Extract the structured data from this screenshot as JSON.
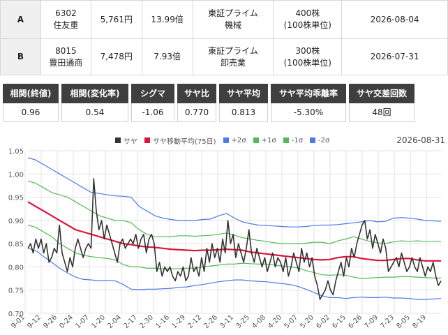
{
  "pairs": [
    {
      "label": "A",
      "code": "6302",
      "name": "住友重",
      "price": "5,761円",
      "per": "13.99倍",
      "market": "東証プライム",
      "sector": "機械",
      "shares": "400株",
      "unit": "(100株単位)",
      "date": "2026-08-04"
    },
    {
      "label": "B",
      "code": "8015",
      "name": "豊田通商",
      "price": "7,478円",
      "per": "7.93倍",
      "market": "東証プライム",
      "sector": "卸売業",
      "shares": "300株",
      "unit": "(100株単位)",
      "date": "2026-07-31"
    }
  ],
  "stats": [
    {
      "label": "相関(終値)",
      "value": "0.96"
    },
    {
      "label": "相関(変化率)",
      "value": "0.54"
    },
    {
      "label": "シグマ",
      "value": "-1.06"
    },
    {
      "label": "サヤ比",
      "value": "0.770"
    },
    {
      "label": "サヤ平均",
      "value": "0.813"
    },
    {
      "label": "サヤ平均乖離率",
      "value": "-5.30%"
    },
    {
      "label": "サヤ交差回数",
      "value": "48回"
    }
  ],
  "chart_data": {
    "type": "line",
    "date_label": "2026-08-31",
    "legend": [
      {
        "name": "サヤ",
        "color": "#333333"
      },
      {
        "name": "サヤ移動平均(75日)",
        "color": "#dc143c"
      },
      {
        "name": "+2σ",
        "color": "#4b7be5"
      },
      {
        "name": "+1σ",
        "color": "#55b855"
      },
      {
        "name": "-1σ",
        "color": "#55b855"
      },
      {
        "name": "-2σ",
        "color": "#4b7be5"
      }
    ],
    "colors": {
      "saya": "#333333",
      "ma": "#dc143c",
      "sigma2": "#4b7be5",
      "sigma1": "#55b855"
    },
    "ylim": [
      0.7,
      1.05
    ],
    "yticks": [
      "1.05",
      "1.00",
      "0.95",
      "0.90",
      "0.85",
      "0.80",
      "0.75",
      "0.70"
    ],
    "xticks": [
      "9-01",
      "9-12",
      "9-26",
      "0-24",
      "1-07",
      "1-20",
      "2-04",
      "2-17",
      "2-30",
      "1-16",
      "1-29",
      "2-12",
      "2-26",
      "3-11",
      "3-25",
      "4-08",
      "4-20",
      "5-07",
      "5-20",
      "6-02",
      "6-15",
      "6-26",
      "7-09",
      "7-23",
      "8-05",
      "8-19"
    ],
    "saya": [
      0.84,
      0.85,
      0.83,
      0.86,
      0.84,
      0.86,
      0.83,
      0.85,
      0.81,
      0.82,
      0.84,
      0.83,
      0.89,
      0.83,
      0.81,
      0.79,
      0.82,
      0.8,
      0.84,
      0.86,
      0.84,
      0.82,
      0.84,
      0.85,
      0.84,
      0.99,
      0.92,
      0.88,
      0.9,
      0.86,
      0.89,
      0.87,
      0.85,
      0.83,
      0.81,
      0.85,
      0.86,
      0.84,
      0.85,
      0.86,
      0.85,
      0.87,
      0.84,
      0.86,
      0.87,
      0.83,
      0.86,
      0.87,
      0.85,
      0.79,
      0.81,
      0.78,
      0.8,
      0.79,
      0.8,
      0.78,
      0.77,
      0.79,
      0.78,
      0.8,
      0.77,
      0.78,
      0.82,
      0.79,
      0.8,
      0.78,
      0.82,
      0.79,
      0.84,
      0.81,
      0.85,
      0.82,
      0.84,
      0.81,
      0.86,
      0.83,
      0.9,
      0.85,
      0.87,
      0.82,
      0.85,
      0.83,
      0.81,
      0.84,
      0.88,
      0.83,
      0.81,
      0.84,
      0.82,
      0.8,
      0.82,
      0.79,
      0.81,
      0.83,
      0.8,
      0.82,
      0.81,
      0.79,
      0.82,
      0.78,
      0.8,
      0.83,
      0.81,
      0.79,
      0.84,
      0.81,
      0.83,
      0.8,
      0.82,
      0.78,
      0.76,
      0.73,
      0.74,
      0.75,
      0.77,
      0.75,
      0.74,
      0.77,
      0.79,
      0.81,
      0.78,
      0.82,
      0.8,
      0.84,
      0.82,
      0.85,
      0.87,
      0.89,
      0.9,
      0.86,
      0.88,
      0.84,
      0.87,
      0.85,
      0.83,
      0.86,
      0.84,
      0.79,
      0.8,
      0.81,
      0.82,
      0.8,
      0.83,
      0.81,
      0.79,
      0.8,
      0.82,
      0.8,
      0.79,
      0.82,
      0.8,
      0.78,
      0.8,
      0.79,
      0.81,
      0.78,
      0.76,
      0.77
    ],
    "ma": [
      0.94,
      0.93,
      0.92,
      0.91,
      0.9,
      0.89,
      0.88,
      0.875,
      0.87,
      0.865,
      0.86,
      0.855,
      0.85,
      0.848,
      0.845,
      0.843,
      0.842,
      0.84,
      0.838,
      0.837,
      0.836,
      0.835,
      0.836,
      0.836,
      0.837,
      0.838,
      0.837,
      0.836,
      0.832,
      0.83,
      0.828,
      0.826,
      0.824,
      0.822,
      0.82,
      0.818,
      0.816,
      0.815,
      0.816,
      0.82,
      0.822,
      0.822,
      0.818,
      0.816,
      0.814,
      0.814,
      0.816,
      0.818,
      0.818,
      0.815,
      0.813,
      0.813,
      0.813
    ],
    "p2": [
      1.035,
      1.03,
      1.02,
      1.01,
      1.0,
      0.99,
      0.98,
      0.97,
      0.96,
      0.958,
      0.955,
      0.953,
      0.952,
      0.95,
      0.93,
      0.92,
      0.91,
      0.905,
      0.902,
      0.9,
      0.9,
      0.9,
      0.902,
      0.903,
      0.91,
      0.915,
      0.905,
      0.897,
      0.893,
      0.89,
      0.889,
      0.888,
      0.887,
      0.886,
      0.886,
      0.887,
      0.889,
      0.89,
      0.89,
      0.891,
      0.893,
      0.895,
      0.897,
      0.9,
      0.897,
      0.898,
      0.905,
      0.906,
      0.905,
      0.903,
      0.9,
      0.899,
      0.898
    ],
    "p1": [
      0.985,
      0.98,
      0.97,
      0.96,
      0.955,
      0.95,
      0.94,
      0.93,
      0.92,
      0.91,
      0.905,
      0.9,
      0.9,
      0.895,
      0.88,
      0.87,
      0.865,
      0.865,
      0.865,
      0.867,
      0.867,
      0.866,
      0.867,
      0.868,
      0.87,
      0.873,
      0.868,
      0.863,
      0.86,
      0.857,
      0.855,
      0.852,
      0.85,
      0.85,
      0.85,
      0.851,
      0.853,
      0.853,
      0.85,
      0.856,
      0.86,
      0.865,
      0.86,
      0.855,
      0.852,
      0.85,
      0.854,
      0.856,
      0.855,
      0.856,
      0.855,
      0.855,
      0.855
    ],
    "m1": [
      0.89,
      0.885,
      0.875,
      0.865,
      0.85,
      0.84,
      0.83,
      0.825,
      0.822,
      0.82,
      0.818,
      0.815,
      0.805,
      0.8,
      0.8,
      0.797,
      0.797,
      0.796,
      0.796,
      0.796,
      0.797,
      0.797,
      0.8,
      0.802,
      0.804,
      0.806,
      0.806,
      0.808,
      0.807,
      0.806,
      0.806,
      0.804,
      0.802,
      0.8,
      0.798,
      0.792,
      0.788,
      0.783,
      0.782,
      0.783,
      0.782,
      0.778,
      0.775,
      0.776,
      0.777,
      0.778,
      0.778,
      0.779,
      0.779,
      0.778,
      0.777,
      0.776,
      0.776
    ],
    "m2": [
      0.84,
      0.835,
      0.822,
      0.81,
      0.797,
      0.787,
      0.778,
      0.773,
      0.772,
      0.77,
      0.771,
      0.77,
      0.762,
      0.752,
      0.751,
      0.752,
      0.752,
      0.753,
      0.754,
      0.756,
      0.757,
      0.76,
      0.762,
      0.765,
      0.768,
      0.77,
      0.772,
      0.772,
      0.77,
      0.769,
      0.768,
      0.766,
      0.764,
      0.762,
      0.758,
      0.752,
      0.745,
      0.738,
      0.734,
      0.734,
      0.732,
      0.734,
      0.735,
      0.734,
      0.734,
      0.735,
      0.733,
      0.733,
      0.732,
      0.73,
      0.73,
      0.731,
      0.732
    ]
  }
}
